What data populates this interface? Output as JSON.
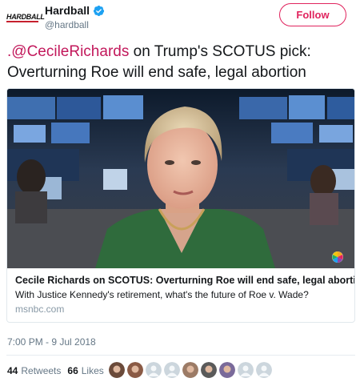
{
  "account": {
    "logo_text": "HARDBALL",
    "display_name": "Hardball",
    "handle": "@hardball"
  },
  "follow_label": "Follow",
  "tweet": {
    "mention": ".@CecileRichards",
    "text": " on Trump's SCOTUS pick: Overturning Roe will end safe, legal abortion"
  },
  "card": {
    "title": "Cecile Richards on SCOTUS: Overturning Roe will end safe, legal abortion",
    "description": "With Justice Kennedy's retirement, what's the future of Roe v. Wade?",
    "domain": "msnbc.com"
  },
  "timestamp": "7:00 PM - 9 Jul 2018",
  "stats": {
    "retweets_count": "44",
    "retweets_label": "Retweets",
    "likes_count": "66",
    "likes_label": "Likes"
  },
  "likers": [
    "avatar-photo",
    "avatar-photo",
    "default-avatar",
    "default-avatar",
    "avatar-photo",
    "avatar-photo",
    "avatar-photo",
    "default-avatar",
    "default-avatar"
  ],
  "colors": {
    "accent": "#e0245e",
    "mention": "#c2185b",
    "verified": "#1da1f2",
    "secondary_text": "#657786"
  }
}
